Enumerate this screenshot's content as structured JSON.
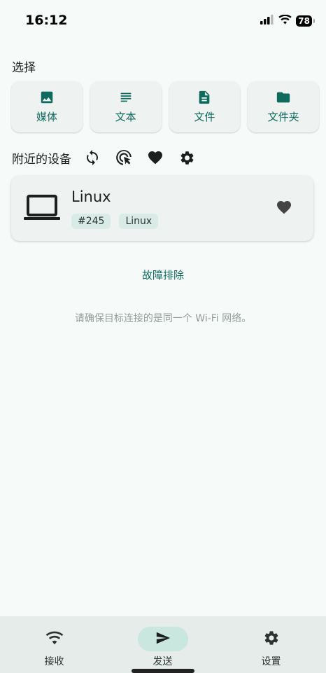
{
  "status_bar": {
    "time": "16:12",
    "battery": "78"
  },
  "select_section": {
    "title": "选择",
    "buttons": [
      {
        "label": "媒体",
        "icon": "image-icon"
      },
      {
        "label": "文本",
        "icon": "text-lines-icon"
      },
      {
        "label": "文件",
        "icon": "file-icon"
      },
      {
        "label": "文件夹",
        "icon": "folder-icon"
      }
    ]
  },
  "nearby_section": {
    "title": "附近的设备",
    "tools": [
      "refresh-icon",
      "touch-target-icon",
      "heart-icon",
      "gear-icon"
    ]
  },
  "device": {
    "name": "Linux",
    "tags": [
      "#245",
      "Linux"
    ],
    "icon": "laptop-icon"
  },
  "troubleshoot_label": "故障排除",
  "hint_text": "请确保目标连接的是同一个 Wi-Fi 网络。",
  "bottom_nav": {
    "items": [
      {
        "label": "接收",
        "icon": "wifi-icon",
        "active": false
      },
      {
        "label": "发送",
        "icon": "send-icon",
        "active": true
      },
      {
        "label": "设置",
        "icon": "gear-icon",
        "active": false
      }
    ]
  },
  "colors": {
    "accent": "#0f6a5e",
    "background": "#f6fbf9",
    "card": "#eef3f1",
    "chip": "#d9ebe6",
    "nav_active": "#c9e6df"
  }
}
